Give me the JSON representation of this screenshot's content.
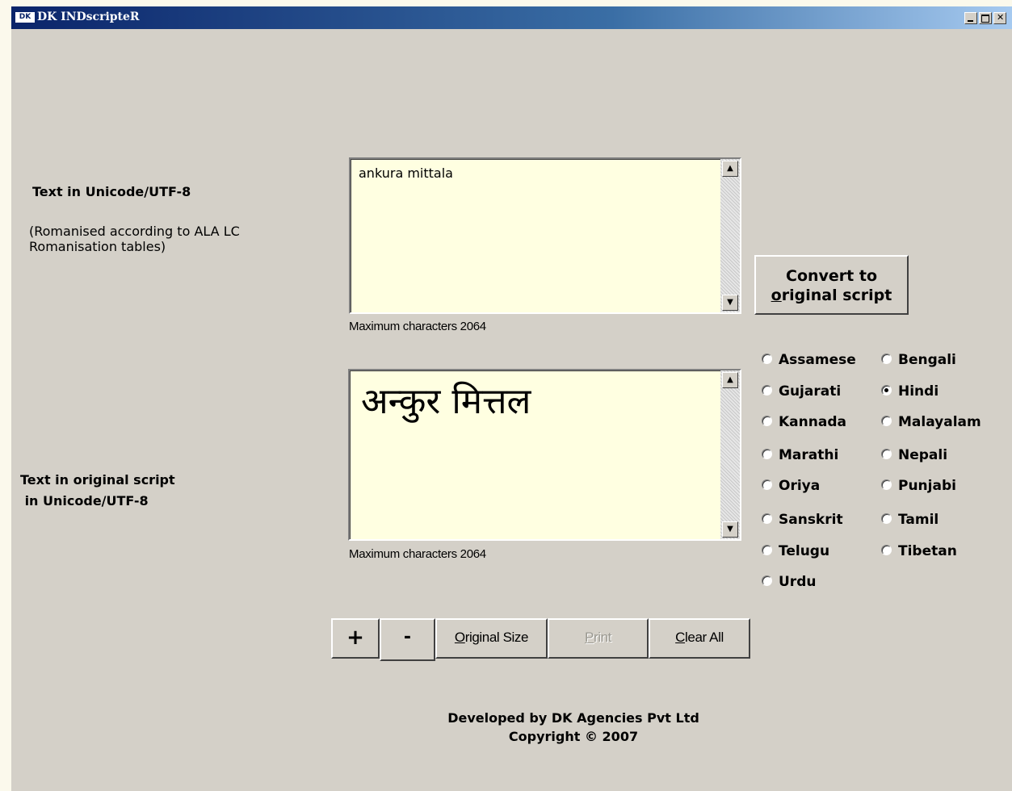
{
  "window": {
    "title": "DK INDscripteR",
    "icon": "DK"
  },
  "input_section": {
    "label": "Text in Unicode/UTF-8",
    "sublabel": "(Romanised according to ALA LC\nRomanisation tables)",
    "text": "ankura mittala",
    "max_chars": "Maximum characters 2064"
  },
  "output_section": {
    "label": "Text in original script\n in Unicode/UTF-8",
    "text": "अन्कुर मित्तल",
    "max_chars": "Maximum characters 2064"
  },
  "convert_button": {
    "line1": "Convert to",
    "line2_underlined": "o",
    "line2_rest": "riginal script"
  },
  "languages": [
    {
      "label": "Assamese",
      "selected": false
    },
    {
      "label": "Bengali",
      "selected": false
    },
    {
      "label": "Gujarati",
      "selected": false
    },
    {
      "label": "Hindi",
      "selected": true
    },
    {
      "label": "Kannada",
      "selected": false
    },
    {
      "label": "Malayalam",
      "selected": false
    },
    {
      "label": "Marathi",
      "selected": false
    },
    {
      "label": "Nepali",
      "selected": false
    },
    {
      "label": "Oriya",
      "selected": false
    },
    {
      "label": "Punjabi",
      "selected": false
    },
    {
      "label": "Sanskrit",
      "selected": false
    },
    {
      "label": "Tamil",
      "selected": false
    },
    {
      "label": "Telugu",
      "selected": false
    },
    {
      "label": "Tibetan",
      "selected": false
    },
    {
      "label": "Urdu",
      "selected": false
    }
  ],
  "toolbar": {
    "zoom_in": "+",
    "zoom_out": "-",
    "original_size_mnemonic": "O",
    "original_size_rest": "riginal Size",
    "print_mnemonic": "P",
    "print_rest": "rint",
    "print_enabled": false,
    "clear_mnemonic": "C",
    "clear_rest": "lear All"
  },
  "footer": {
    "line1": "Developed by DK Agencies Pvt Ltd",
    "line2": "Copyright © 2007"
  }
}
